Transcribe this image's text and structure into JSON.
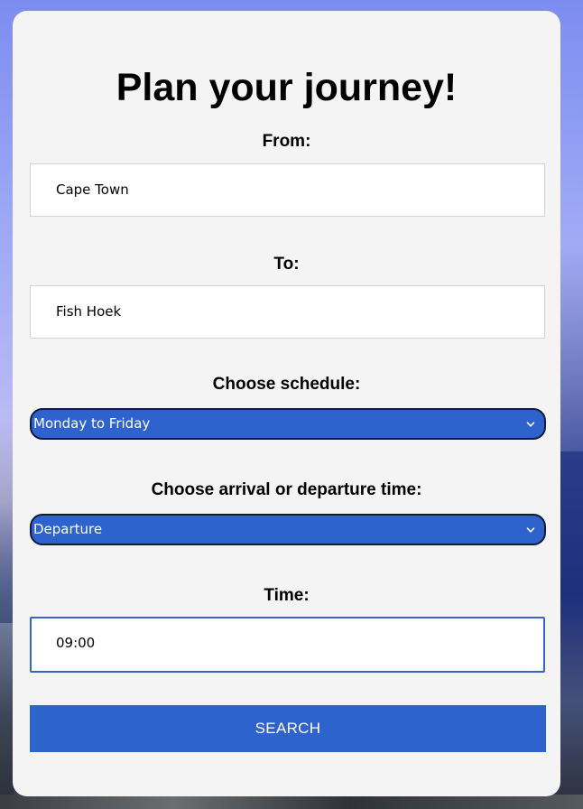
{
  "title": "Plan your journey!",
  "from": {
    "label": "From:",
    "value": "Cape Town"
  },
  "to": {
    "label": "To:",
    "value": "Fish Hoek"
  },
  "schedule": {
    "label": "Choose schedule:",
    "selected": "Monday to Friday"
  },
  "time_type": {
    "label": "Choose arrival or departure time:",
    "selected": "Departure"
  },
  "time": {
    "label": "Time:",
    "value": "09:00"
  },
  "search_label": "SEARCH",
  "colors": {
    "accent": "#2e62cc",
    "card": "#f4f4f4"
  },
  "icons": {
    "dropdown": "chevron-down-icon"
  }
}
